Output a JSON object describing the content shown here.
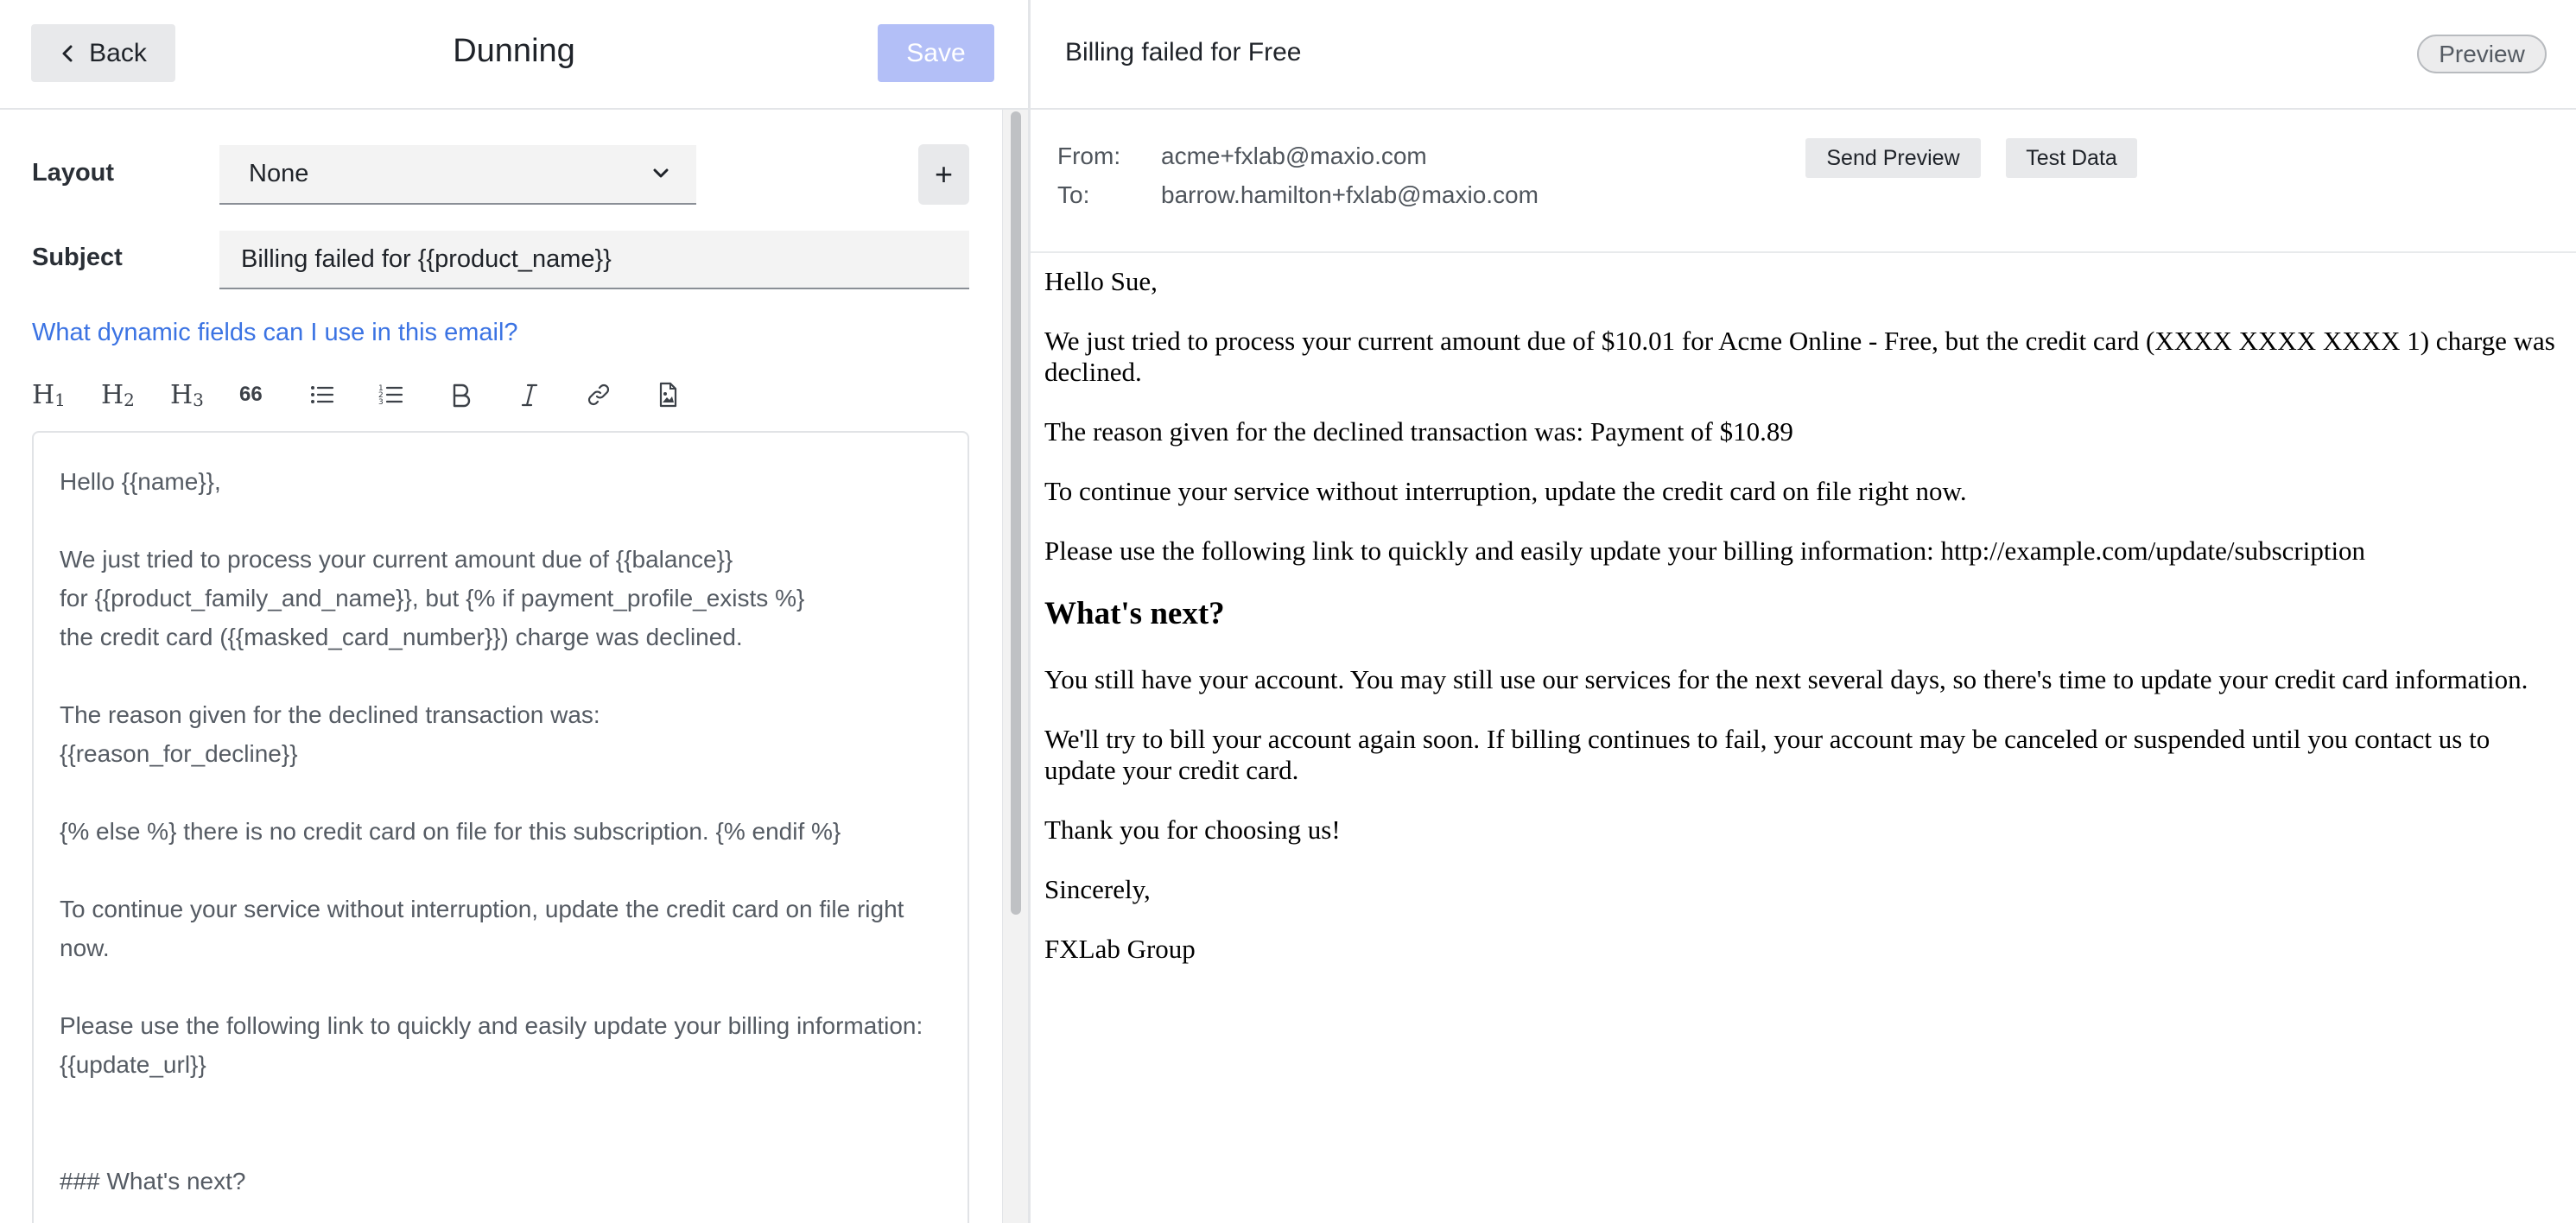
{
  "editor": {
    "back_label": "Back",
    "title": "Dunning",
    "save_label": "Save",
    "layout_label": "Layout",
    "layout_value": "None",
    "add_label": "+",
    "subject_label": "Subject",
    "subject_value": "Billing failed for {{product_name}}",
    "help_link": "What dynamic fields can I use in this email?",
    "toolbar": {
      "h1": "H",
      "h1_sub": "1",
      "h2": "H",
      "h2_sub": "2",
      "h3": "H",
      "h3_sub": "3",
      "quote": "66"
    },
    "body_lines": [
      "Hello {{name}},",
      "",
      "We just tried to process your current amount due of {{balance}}",
      "for {{product_family_and_name}}, but {% if payment_profile_exists %}",
      "the credit card ({{masked_card_number}}) charge was declined.",
      "",
      "The reason given for the declined transaction was:",
      "{{reason_for_decline}}",
      "",
      "{% else %} there is no credit card on file for this subscription. {% endif %}",
      "",
      "To continue your service without interruption, update the credit card on file right",
      "now.",
      "",
      "Please use the following link to quickly and easily update your billing information:",
      "{{update_url}}",
      "",
      "",
      "### What's next?"
    ]
  },
  "preview": {
    "title": "Billing failed for Free",
    "badge": "Preview",
    "from_label": "From:",
    "from_value": "acme+fxlab@maxio.com",
    "to_label": "To:",
    "to_value": "barrow.hamilton+fxlab@maxio.com",
    "send_preview_label": "Send Preview",
    "test_data_label": "Test Data",
    "email": {
      "greeting": "Hello Sue,",
      "p1": "We just tried to process your current amount due of $10.01 for Acme Online - Free, but the credit card (XXXX XXXX XXXX 1) charge was declined.",
      "p2": "The reason given for the declined transaction was: Payment of $10.89",
      "p3": "To continue your service without interruption, update the credit card on file right now.",
      "p4": "Please use the following link to quickly and easily update your billing information: http://example.com/update/subscription",
      "heading": "What's next?",
      "p5": "You still have your account. You may still use our services for the next several days, so there's time to update your credit card information.",
      "p6": "We'll try to bill your account again soon. If billing continues to fail, your account may be canceled or suspended until you contact us to update your credit card.",
      "p7": "Thank you for choosing us!",
      "p8": "Sincerely,",
      "p9": "FXLab Group"
    }
  },
  "icons": [
    "chevron-left-icon",
    "chevron-down-icon",
    "bulleted-list-icon",
    "numbered-list-icon",
    "bold-icon",
    "italic-icon",
    "link-icon",
    "insert-file-icon"
  ]
}
